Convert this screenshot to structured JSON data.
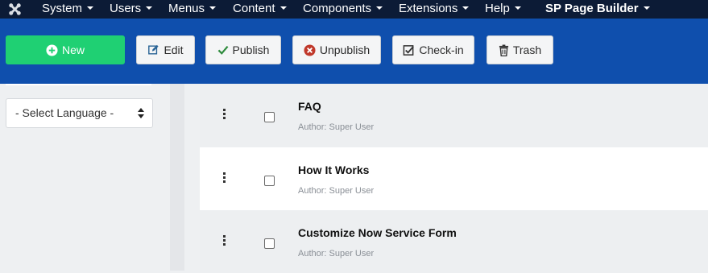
{
  "menubar": {
    "items": [
      {
        "label": "System"
      },
      {
        "label": "Users"
      },
      {
        "label": "Menus"
      },
      {
        "label": "Content"
      },
      {
        "label": "Components"
      },
      {
        "label": "Extensions"
      },
      {
        "label": "Help"
      },
      {
        "label": "SP Page Builder"
      }
    ]
  },
  "toolbar": {
    "new_label": "New",
    "edit_label": "Edit",
    "publish_label": "Publish",
    "unpublish_label": "Unpublish",
    "checkin_label": "Check-in",
    "trash_label": "Trash"
  },
  "sidebar": {
    "language_select": "- Select Language -"
  },
  "pages": [
    {
      "title": "FAQ",
      "author": "Author: Super User"
    },
    {
      "title": "How It Works",
      "author": "Author: Super User"
    },
    {
      "title": "Customize Now Service Form",
      "author": "Author: Super User"
    }
  ],
  "colors": {
    "topbar": "#0c1b36",
    "toolbar": "#0f4fad",
    "new_button": "#1fd073",
    "publish_icon": "#2e8b3d",
    "unpublish_icon": "#c0392b"
  }
}
